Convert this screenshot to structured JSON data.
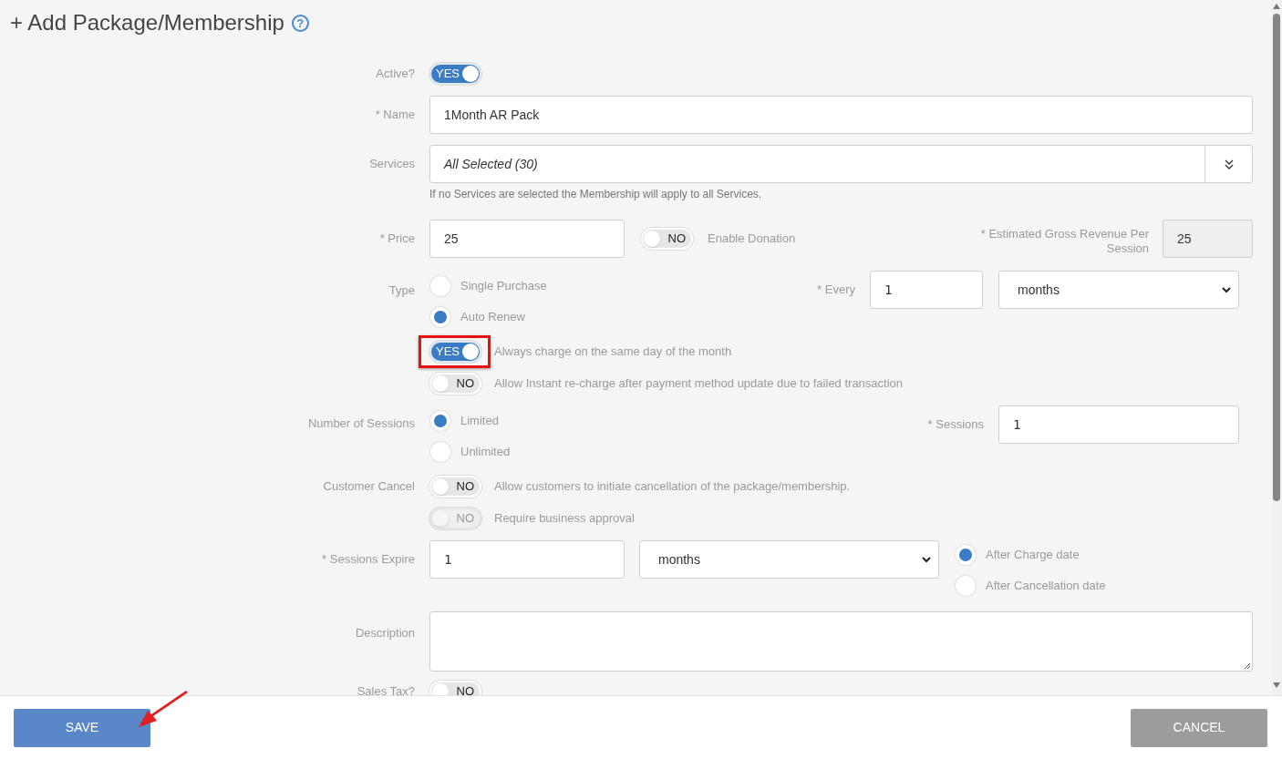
{
  "title": "+ Add Package/Membership",
  "help": "?",
  "active": {
    "label": "Active?",
    "toggle": {
      "on": true,
      "text": "YES",
      "disabled": false
    }
  },
  "name": {
    "label": "* Name",
    "value": "1Month AR Pack"
  },
  "services": {
    "label": "Services",
    "value": "All Selected (30)",
    "hint": "If no Services are selected the Membership will apply to all Services."
  },
  "price": {
    "label": "* Price",
    "value": "25",
    "donation_toggle": {
      "on": false,
      "text": "NO",
      "disabled": false
    },
    "donation_label": "Enable Donation",
    "revenue_label": "* Estimated Gross Revenue Per Session",
    "revenue_value": "25"
  },
  "type": {
    "label": "Type",
    "options": [
      {
        "label": "Single Purchase",
        "selected": false
      },
      {
        "label": "Auto Renew",
        "selected": true
      }
    ],
    "every_label": "* Every",
    "every_value": "1",
    "every_unit": "months"
  },
  "renew_toggles": [
    {
      "on": true,
      "text": "YES",
      "label": "Always charge on the same day of the month",
      "disabled": false,
      "highlighted": true
    },
    {
      "on": false,
      "text": "NO",
      "label": "Allow Instant re-charge after payment method update due to failed transaction",
      "disabled": false,
      "highlighted": false
    }
  ],
  "sessions": {
    "label": "Number of Sessions",
    "options": [
      {
        "label": "Limited",
        "selected": true
      },
      {
        "label": "Unlimited",
        "selected": false
      }
    ],
    "count_label": "* Sessions",
    "count_value": "1"
  },
  "cancel": {
    "label": "Customer Cancel",
    "toggles": [
      {
        "on": false,
        "text": "NO",
        "label": "Allow customers to initiate cancellation of the package/membership.",
        "disabled": false
      },
      {
        "on": false,
        "text": "NO",
        "label": "Require business approval",
        "disabled": true
      }
    ]
  },
  "expire": {
    "label": "* Sessions Expire",
    "value": "1",
    "unit": "months",
    "options": [
      {
        "label": "After Charge date",
        "selected": true
      },
      {
        "label": "After Cancellation date",
        "selected": false
      }
    ]
  },
  "description": {
    "label": "Description"
  },
  "sales_tax": {
    "label": "Sales Tax?",
    "toggle": {
      "on": false,
      "text": "NO",
      "disabled": false
    }
  },
  "buttons": {
    "save": "SAVE",
    "cancel": "CANCEL"
  }
}
